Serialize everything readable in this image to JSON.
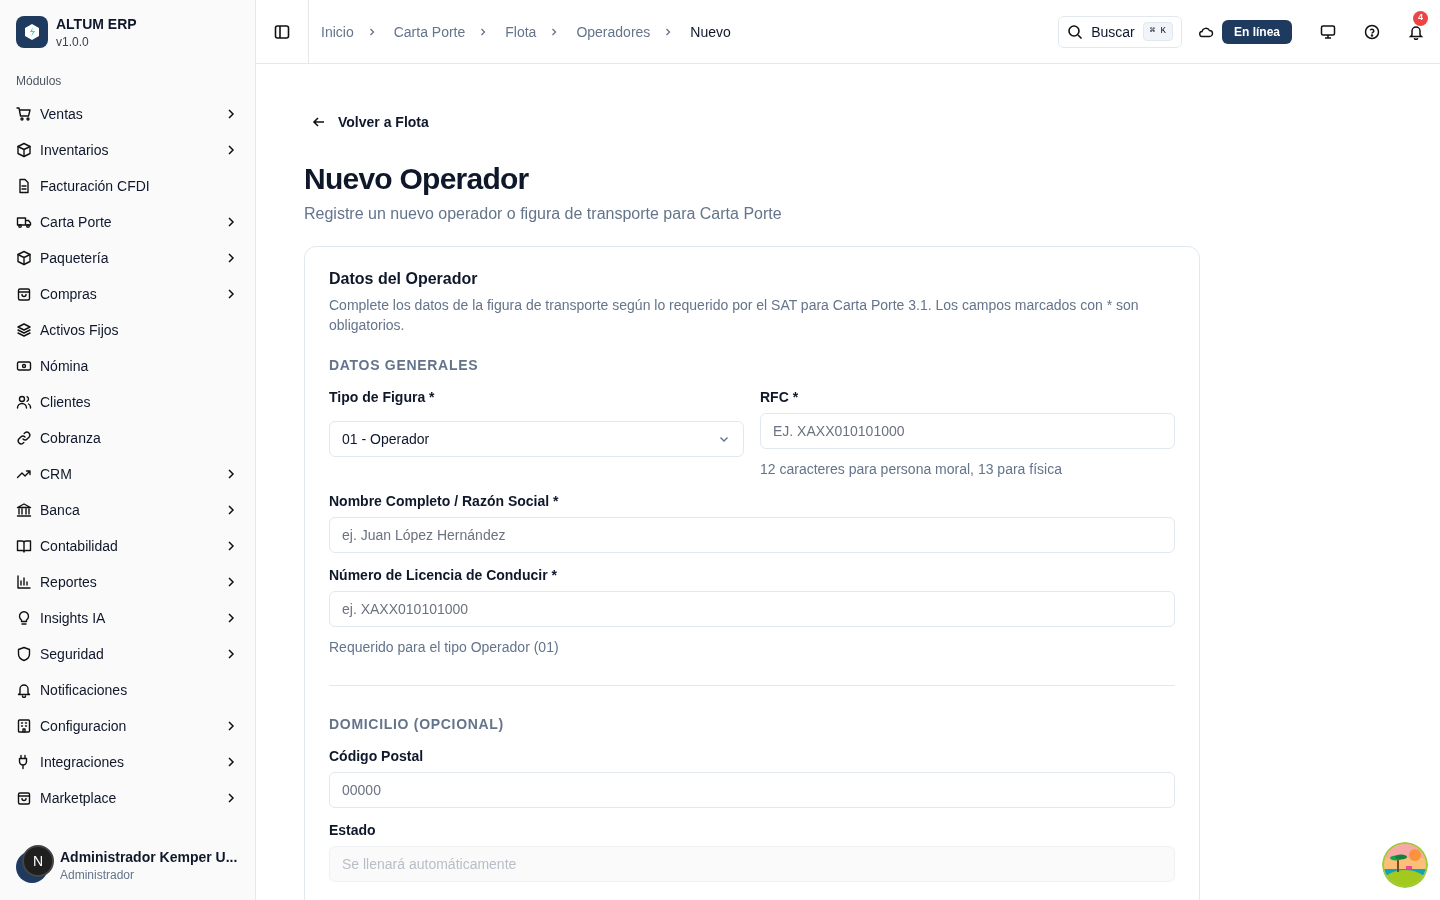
{
  "brand": {
    "name": "ALTUM ERP",
    "version": "v1.0.0"
  },
  "sidebar": {
    "section": "Módulos",
    "items": [
      {
        "label": "Ventas",
        "expandable": true
      },
      {
        "label": "Inventarios",
        "expandable": true
      },
      {
        "label": "Facturación CFDI",
        "expandable": false
      },
      {
        "label": "Carta Porte",
        "expandable": true
      },
      {
        "label": "Paquetería",
        "expandable": true
      },
      {
        "label": "Compras",
        "expandable": true
      },
      {
        "label": "Activos Fijos",
        "expandable": false
      },
      {
        "label": "Nómina",
        "expandable": false
      },
      {
        "label": "Clientes",
        "expandable": false
      },
      {
        "label": "Cobranza",
        "expandable": false
      },
      {
        "label": "CRM",
        "expandable": true
      },
      {
        "label": "Banca",
        "expandable": true
      },
      {
        "label": "Contabilidad",
        "expandable": true
      },
      {
        "label": "Reportes",
        "expandable": true
      },
      {
        "label": "Insights IA",
        "expandable": true
      },
      {
        "label": "Seguridad",
        "expandable": true
      },
      {
        "label": "Notificaciones",
        "expandable": false
      },
      {
        "label": "Configuracion",
        "expandable": true
      },
      {
        "label": "Integraciones",
        "expandable": true
      },
      {
        "label": "Marketplace",
        "expandable": true
      }
    ],
    "user": {
      "initial": "N",
      "name": "Administrador Kemper U...",
      "role": "Administrador"
    }
  },
  "breadcrumbs": [
    "Inicio",
    "Carta Porte",
    "Flota",
    "Operadores",
    "Nuevo"
  ],
  "topbar": {
    "search": "Buscar",
    "shortcut": "⌘ K",
    "status": "En línea",
    "notifications": "4"
  },
  "back_link": "Volver a Flota",
  "page": {
    "title": "Nuevo Operador",
    "subtitle": "Registre un nuevo operador o figura de transporte para Carta Porte"
  },
  "card": {
    "title": "Datos del Operador",
    "description": "Complete los datos de la figura de transporte según lo requerido por el SAT para Carta Porte 3.1. Los campos marcados con * son obligatorios.",
    "sections": [
      {
        "heading": "DATOS GENERALES",
        "fields": [
          {
            "kind": "select",
            "label": "Tipo de Figura *",
            "value": "01 - Operador",
            "half": true
          },
          {
            "kind": "input",
            "label": "RFC *",
            "placeholder": "EJ. XAXX010101000",
            "help": "12 caracteres para persona moral, 13 para física",
            "half": true
          },
          {
            "kind": "input",
            "label": "Nombre Completo / Razón Social *",
            "placeholder": "ej. Juan López Hernández",
            "half": false
          },
          {
            "kind": "input",
            "label": "Número de Licencia de Conducir *",
            "placeholder": "ej. XAXX010101000",
            "help": "Requerido para el tipo Operador (01)",
            "half": false
          }
        ]
      },
      {
        "heading": "DOMICILIO (OPCIONAL)",
        "fields": [
          {
            "kind": "input",
            "label": "Código Postal",
            "placeholder": "00000",
            "half": false
          },
          {
            "kind": "input",
            "label": "Estado",
            "placeholder": "Se llenará automáticamente",
            "disabled": true,
            "half": false
          }
        ]
      }
    ]
  }
}
